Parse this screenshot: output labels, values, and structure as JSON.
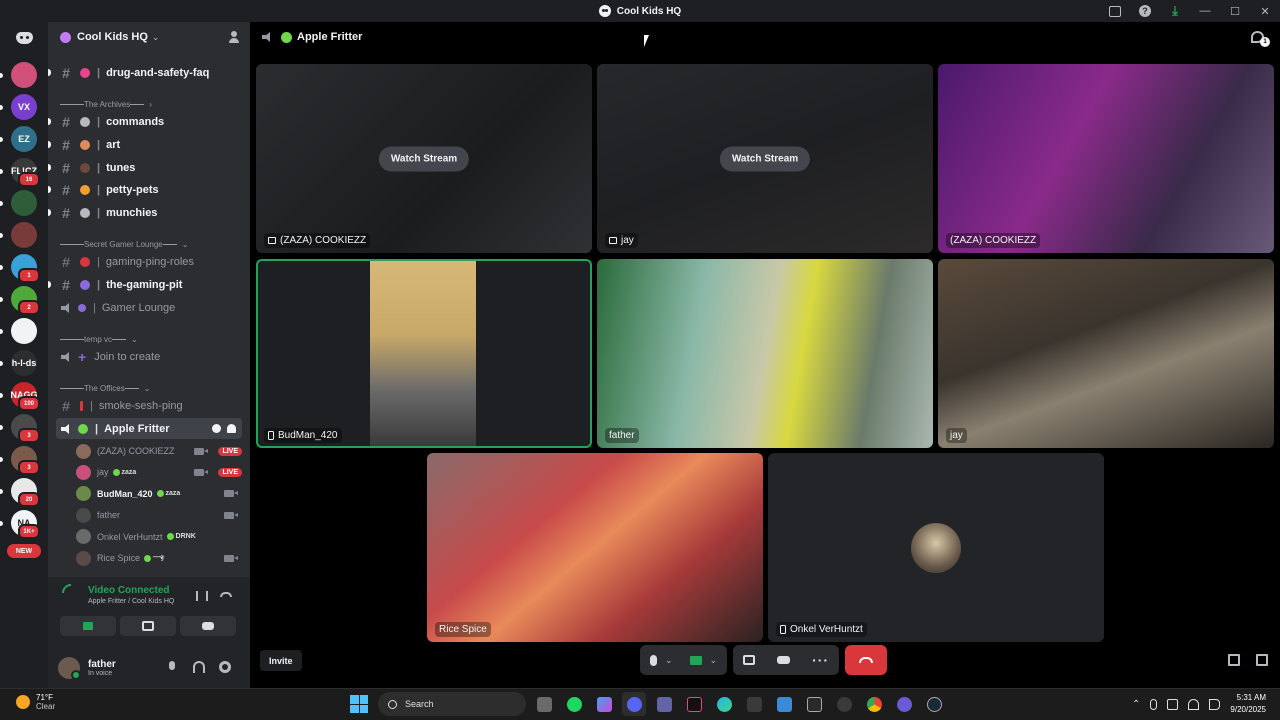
{
  "window": {
    "title": "Cool Kids HQ"
  },
  "rail": {
    "servers": [
      {
        "name": "server-rainbow",
        "color": "#d0507a",
        "label": "",
        "badge": ""
      },
      {
        "name": "server-vx",
        "color": "#7b3fd0",
        "label": "VX",
        "badge": ""
      },
      {
        "name": "server-ez",
        "color": "#2f6f8a",
        "label": "EZ",
        "badge": ""
      },
      {
        "name": "server-flicz",
        "color": "#3a3a3a",
        "label": "FL!CZ",
        "badge": "16"
      },
      {
        "name": "server-figure",
        "color": "#2f5d3a",
        "label": "",
        "badge": ""
      },
      {
        "name": "server-red",
        "color": "#7a3a3a",
        "label": "",
        "badge": ""
      },
      {
        "name": "server-bird",
        "color": "#3aa0d8",
        "label": "",
        "badge": "1"
      },
      {
        "name": "server-green",
        "color": "#4fa83a",
        "label": "",
        "badge": "2"
      },
      {
        "name": "server-face",
        "color": "#f2f3f5",
        "label": "",
        "badge": ""
      },
      {
        "name": "server-hlds",
        "color": "#2b2d31",
        "label": "h-l-ds",
        "badge": ""
      },
      {
        "name": "server-nagg",
        "color": "#c8242c",
        "label": "NAGG",
        "badge": "100"
      },
      {
        "name": "server-dark",
        "color": "#4a4a4a",
        "label": "",
        "badge": "3"
      },
      {
        "name": "server-group",
        "color": "#7a5a4a",
        "label": "",
        "badge": "3"
      },
      {
        "name": "server-x",
        "color": "#e8e8e8",
        "label": "",
        "badge": "20"
      },
      {
        "name": "server-na",
        "color": "#f2f3f5",
        "label": "NA",
        "badge": "1K+"
      }
    ],
    "new_label": "NEW"
  },
  "sidebar": {
    "guild_name": "Cool Kids HQ",
    "channels_top": [
      {
        "name": "drug-and-safety-faq",
        "emoji_color": "#e8458c",
        "unread": true
      },
      {
        "name": "commands",
        "emoji_color": "#b5bac1",
        "unread": true
      },
      {
        "name": "art",
        "emoji_color": "#e08a5a",
        "unread": true
      },
      {
        "name": "tunes",
        "emoji_color": "#6b4a3a",
        "unread": true
      },
      {
        "name": "petty-pets",
        "emoji_color": "#f0a030",
        "unread": true
      },
      {
        "name": "munchies",
        "emoji_color": "#b5bac1",
        "unread": true
      }
    ],
    "cat_archives": "The Archives",
    "cat_gamer": "Secret Gamer Lounge",
    "gamer_channels": [
      {
        "name": "gaming-ping-roles",
        "emoji_color": "#da373c",
        "unread": false
      },
      {
        "name": "the-gaming-pit",
        "emoji_color": "#8a6ad8",
        "unread": true
      }
    ],
    "gamer_voice": "Gamer Lounge",
    "cat_temp": "temp vc",
    "join_to_create": "Join to create",
    "cat_offices": "The Offices",
    "offices_channel": "smoke-sesh-ping",
    "active_voice": "Apple Fritter",
    "voice_users": [
      {
        "name": "(ZAZA) COOKIEZZ",
        "av": "#8a6a5a",
        "tag": "",
        "cam": true,
        "live": "LIVE",
        "bold": false
      },
      {
        "name": "jay",
        "av": "#c8507a",
        "tag": "zaza",
        "cam": true,
        "live": "LIVE",
        "bold": false
      },
      {
        "name": "BudMan_420",
        "av": "#6a8a4a",
        "tag": "zaza",
        "cam": true,
        "live": "",
        "bold": true
      },
      {
        "name": "father",
        "av": "#4a4a4a",
        "tag": "",
        "cam": true,
        "live": "",
        "bold": false
      },
      {
        "name": "Onkel VerHuntzt",
        "av": "#6a6a6a",
        "tag": "DRNK",
        "cam": false,
        "live": "",
        "bold": false
      },
      {
        "name": "Rice Spice",
        "av": "#5a4a4a",
        "tag": "—ඉ",
        "cam": true,
        "live": "",
        "bold": false
      }
    ],
    "voice_status": "Video Connected",
    "voice_location": "Apple Fritter / Cool Kids HQ",
    "user": {
      "name": "father",
      "status": "In voice"
    }
  },
  "call": {
    "channel": "Apple Fritter",
    "watch_label": "Watch Stream",
    "tiles": [
      {
        "name": "(ZAZA) COOKIEZZ",
        "kind": "stream"
      },
      {
        "name": "jay",
        "kind": "stream"
      },
      {
        "name": "(ZAZA) COOKIEZZ",
        "kind": "camera"
      },
      {
        "name": "BudMan_420",
        "kind": "camera-mobile"
      },
      {
        "name": "father",
        "kind": "camera"
      },
      {
        "name": "jay",
        "kind": "camera"
      },
      {
        "name": "Rice Spice",
        "kind": "camera"
      },
      {
        "name": "Onkel VerHuntzt",
        "kind": "avatar-mobile"
      }
    ],
    "invite_label": "Invite",
    "accent": "#23a559",
    "danger": "#da373c"
  },
  "taskbar": {
    "temp": "71°F",
    "weather": "Clear",
    "search_placeholder": "Search",
    "time": "5:31 AM",
    "date": "9/20/2025"
  }
}
